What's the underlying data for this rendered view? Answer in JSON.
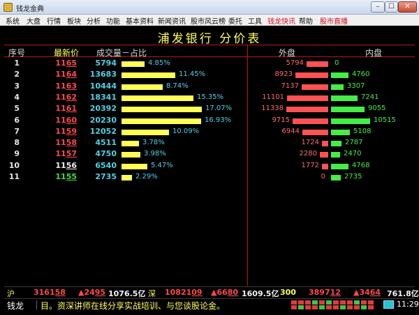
{
  "window": {
    "title": "钱龙金典",
    "min_glyph": "–",
    "max_glyph": "☐",
    "close_glyph": "✕"
  },
  "menu": [
    {
      "label": "系统",
      "red": false
    },
    {
      "label": "大盘",
      "red": false
    },
    {
      "label": "行情",
      "red": false
    },
    {
      "label": "板块",
      "red": false
    },
    {
      "label": "分析",
      "red": false
    },
    {
      "label": "功能",
      "red": false
    },
    {
      "label": "基本资料",
      "red": false
    },
    {
      "label": "新闻资讯",
      "red": false
    },
    {
      "label": "股市风云榜",
      "red": false
    },
    {
      "label": "委托",
      "red": false
    },
    {
      "label": "工具",
      "red": false
    },
    {
      "label": "钱龙快讯",
      "red": true
    },
    {
      "label": "帮助",
      "red": false
    },
    {
      "label": "股市直播",
      "red": true
    }
  ],
  "page": {
    "title": "浦发银行   分价表"
  },
  "headers": {
    "index": "序号",
    "price": "最新价",
    "volume": "成交量－占比",
    "outer": "外盘",
    "inner": "内盘"
  },
  "rows": [
    {
      "idx": "1",
      "price_main": "11",
      "price_sub": "65",
      "trend": "up",
      "volume": "5794",
      "volume_num": 5794,
      "pct": "4.85%",
      "outer": "5794",
      "outer_num": 5794,
      "inner": "0",
      "inner_num": 0
    },
    {
      "idx": "2",
      "price_main": "11",
      "price_sub": "64",
      "trend": "up",
      "volume": "13683",
      "volume_num": 13683,
      "pct": "11.45%",
      "outer": "8923",
      "outer_num": 8923,
      "inner": "4760",
      "inner_num": 4760
    },
    {
      "idx": "3",
      "price_main": "11",
      "price_sub": "63",
      "trend": "up",
      "volume": "10444",
      "volume_num": 10444,
      "pct": "8.74%",
      "outer": "7137",
      "outer_num": 7137,
      "inner": "3307",
      "inner_num": 3307
    },
    {
      "idx": "4",
      "price_main": "11",
      "price_sub": "62",
      "trend": "up",
      "volume": "18341",
      "volume_num": 18341,
      "pct": "15.35%",
      "outer": "11101",
      "outer_num": 11101,
      "inner": "7241",
      "inner_num": 7241
    },
    {
      "idx": "5",
      "price_main": "11",
      "price_sub": "61",
      "trend": "up",
      "volume": "20392",
      "volume_num": 20392,
      "pct": "17.07%",
      "outer": "11338",
      "outer_num": 11338,
      "inner": "9055",
      "inner_num": 9055
    },
    {
      "idx": "6",
      "price_main": "11",
      "price_sub": "60",
      "trend": "up",
      "volume": "20230",
      "volume_num": 20230,
      "pct": "16.93%",
      "outer": "9715",
      "outer_num": 9715,
      "inner": "10515",
      "inner_num": 10515
    },
    {
      "idx": "7",
      "price_main": "11",
      "price_sub": "59",
      "trend": "up",
      "volume": "12052",
      "volume_num": 12052,
      "pct": "10.09%",
      "outer": "6944",
      "outer_num": 6944,
      "inner": "5108",
      "inner_num": 5108
    },
    {
      "idx": "8",
      "price_main": "11",
      "price_sub": "58",
      "trend": "up",
      "volume": "4511",
      "volume_num": 4511,
      "pct": "3.78%",
      "outer": "1724",
      "outer_num": 1724,
      "inner": "2787",
      "inner_num": 2787
    },
    {
      "idx": "9",
      "price_main": "11",
      "price_sub": "57",
      "trend": "up",
      "volume": "4750",
      "volume_num": 4750,
      "pct": "3.98%",
      "outer": "2280",
      "outer_num": 2280,
      "inner": "2470",
      "inner_num": 2470
    },
    {
      "idx": "10",
      "price_main": "11",
      "price_sub": "56",
      "trend": "flat",
      "volume": "6540",
      "volume_num": 6540,
      "pct": "5.47%",
      "outer": "1772",
      "outer_num": 1772,
      "inner": "4768",
      "inner_num": 4768
    },
    {
      "idx": "11",
      "price_main": "11",
      "price_sub": "55",
      "trend": "down",
      "volume": "2735",
      "volume_num": 2735,
      "pct": "2.29%",
      "outer": "0",
      "outer_num": 0,
      "inner": "2735",
      "inner_num": 2735
    }
  ],
  "index_bar": {
    "sh_label": "沪",
    "sh_value_main": "3161",
    "sh_value_sub": "58",
    "sh_change_main": "▲24",
    "sh_change_sub": "95",
    "sh_amount": "1076.5亿",
    "sz_label": "深",
    "sz_value_main": "10821",
    "sz_value_sub": "09",
    "sz_change_main": "▲66",
    "sz_change_sub": "80",
    "sz_amount": "1609.5亿",
    "i300_label": "300",
    "i300_value_main": "3897",
    "i300_value_sub": "12",
    "i300_change_main": "▲34",
    "i300_change_sub": "64",
    "i300_amount": "761.8亿"
  },
  "status": {
    "label": "钱龙",
    "ticker": "目。资深讲师在线分享实战培训、与您谈股论金。",
    "time": "11:29"
  },
  "colors": {
    "up": "#ff4a4a",
    "down": "#44ee44",
    "flat": "#f4f4f4",
    "volume": "#4fd2e6",
    "title": "#ffff55",
    "grid": "#b31818"
  }
}
